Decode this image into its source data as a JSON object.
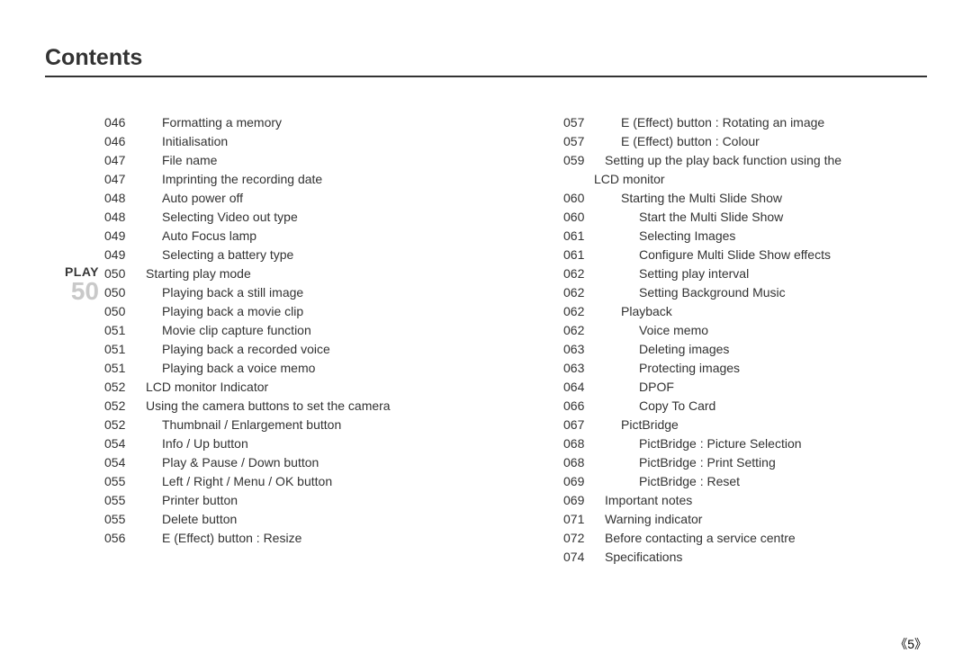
{
  "title": "Contents",
  "page_footer": "《5》",
  "left": {
    "section": {
      "label": "PLAY",
      "number": "50",
      "start_index": 8
    },
    "items": [
      {
        "page": "046",
        "text": "Formatting a memory",
        "indent": 1
      },
      {
        "page": "046",
        "text": "Initialisation",
        "indent": 1
      },
      {
        "page": "047",
        "text": "File name",
        "indent": 1
      },
      {
        "page": "047",
        "text": "Imprinting the recording date",
        "indent": 1
      },
      {
        "page": "048",
        "text": "Auto power off",
        "indent": 1
      },
      {
        "page": "048",
        "text": "Selecting Video out type",
        "indent": 1
      },
      {
        "page": "049",
        "text": "Auto Focus lamp",
        "indent": 1
      },
      {
        "page": "049",
        "text": "Selecting a battery type",
        "indent": 1
      },
      {
        "page": "050",
        "text": "Starting play mode",
        "indent": 0
      },
      {
        "page": "050",
        "text": "Playing back a still image",
        "indent": 1
      },
      {
        "page": "050",
        "text": "Playing back a movie clip",
        "indent": 1
      },
      {
        "page": "051",
        "text": "Movie clip capture function",
        "indent": 1
      },
      {
        "page": "051",
        "text": "Playing back a recorded voice",
        "indent": 1
      },
      {
        "page": "051",
        "text": "Playing back a voice memo",
        "indent": 1
      },
      {
        "page": "052",
        "text": "LCD monitor Indicator",
        "indent": 0
      },
      {
        "page": "052",
        "text": "Using the camera buttons to set the camera",
        "indent": 0
      },
      {
        "page": "052",
        "text": "Thumbnail / Enlargement button",
        "indent": 1
      },
      {
        "page": "054",
        "text": "Info / Up button",
        "indent": 1
      },
      {
        "page": "054",
        "text": "Play & Pause / Down button",
        "indent": 1
      },
      {
        "page": "055",
        "text": "Left / Right / Menu / OK button",
        "indent": 1
      },
      {
        "page": "055",
        "text": "Printer button",
        "indent": 1
      },
      {
        "page": "055",
        "text": "Delete button",
        "indent": 1
      },
      {
        "page": "056",
        "text": "E (Effect) button : Resize",
        "indent": 1
      }
    ]
  },
  "right": {
    "items": [
      {
        "page": "057",
        "text": "E (Effect) button : Rotating an image",
        "indent": 1
      },
      {
        "page": "057",
        "text": "E (Effect) button : Colour",
        "indent": 1
      },
      {
        "page": "059",
        "text": "Setting up the play back function using the",
        "indent": 0
      },
      {
        "page": "",
        "text": "LCD monitor",
        "indent": 0,
        "cont": true
      },
      {
        "page": "060",
        "text": "Starting the Multi Slide Show",
        "indent": 1
      },
      {
        "page": "060",
        "text": "Start the Multi Slide Show",
        "indent": 2
      },
      {
        "page": "061",
        "text": "Selecting Images",
        "indent": 2
      },
      {
        "page": "061",
        "text": "Configure Multi Slide Show effects",
        "indent": 2
      },
      {
        "page": "062",
        "text": "Setting play interval",
        "indent": 2
      },
      {
        "page": "062",
        "text": "Setting Background Music",
        "indent": 2
      },
      {
        "page": "062",
        "text": "Playback",
        "indent": 1
      },
      {
        "page": "062",
        "text": "Voice memo",
        "indent": 2
      },
      {
        "page": "063",
        "text": "Deleting images",
        "indent": 2
      },
      {
        "page": "063",
        "text": "Protecting images",
        "indent": 2
      },
      {
        "page": "064",
        "text": "DPOF",
        "indent": 2
      },
      {
        "page": "066",
        "text": "Copy To Card",
        "indent": 2
      },
      {
        "page": "067",
        "text": "PictBridge",
        "indent": 1
      },
      {
        "page": "068",
        "text": "PictBridge : Picture Selection",
        "indent": 2
      },
      {
        "page": "068",
        "text": "PictBridge : Print Setting",
        "indent": 2
      },
      {
        "page": "069",
        "text": "PictBridge : Reset",
        "indent": 2
      },
      {
        "page": "069",
        "text": "Important notes",
        "indent": 0
      },
      {
        "page": "071",
        "text": "Warning indicator",
        "indent": 0
      },
      {
        "page": "072",
        "text": "Before contacting a service centre",
        "indent": 0
      },
      {
        "page": "074",
        "text": "Specifications",
        "indent": 0
      }
    ]
  }
}
